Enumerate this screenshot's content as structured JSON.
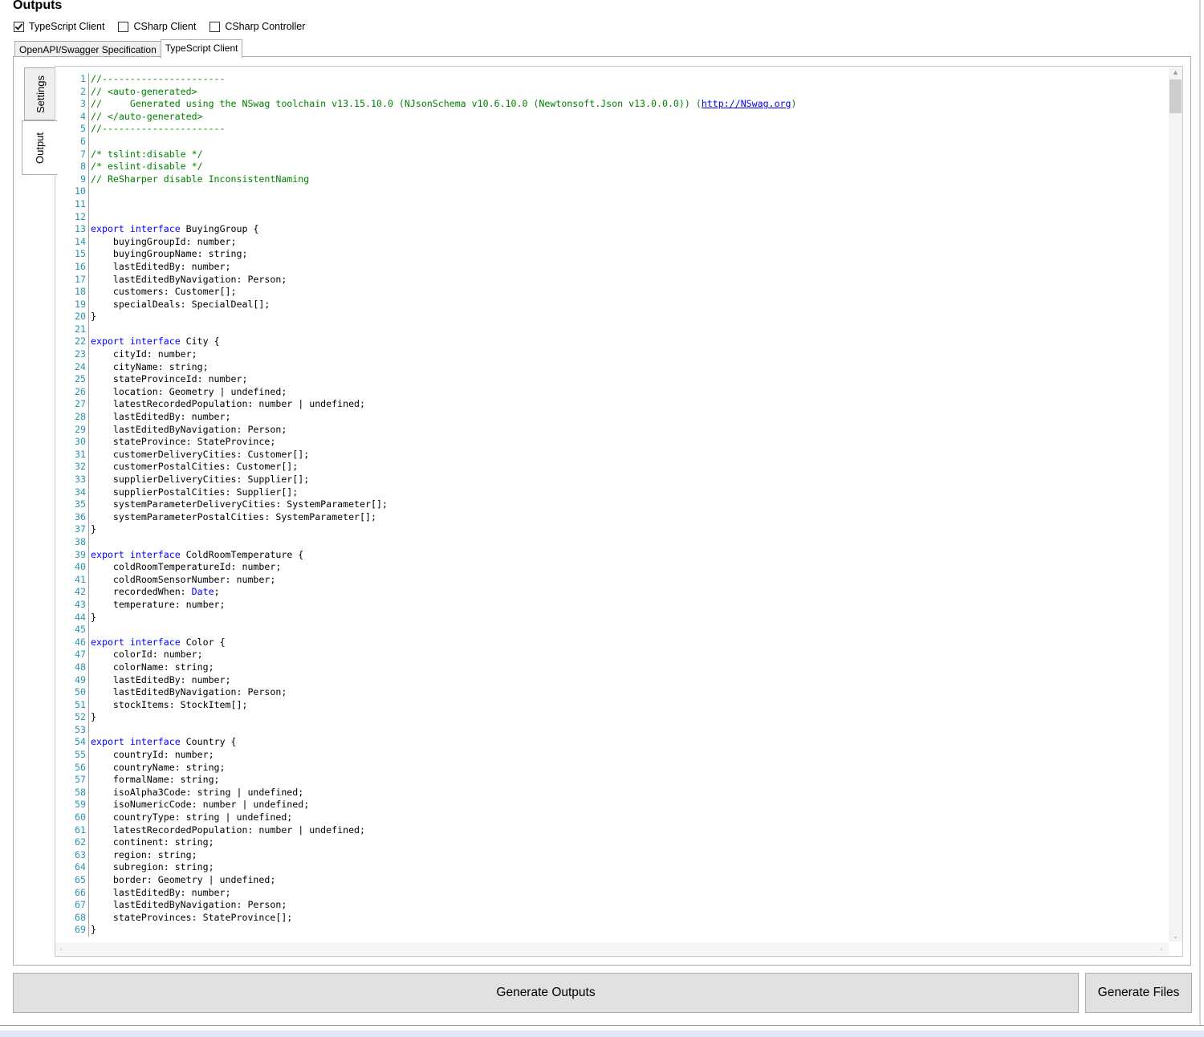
{
  "outputs": {
    "title": "Outputs",
    "checkboxes": [
      {
        "label": "TypeScript Client",
        "checked": true
      },
      {
        "label": "CSharp Client",
        "checked": false
      },
      {
        "label": "CSharp Controller",
        "checked": false
      }
    ]
  },
  "tabs": [
    {
      "label": "OpenAPI/Swagger Specification",
      "active": false
    },
    {
      "label": "TypeScript Client",
      "active": true
    }
  ],
  "side_tabs": [
    {
      "label": "Settings",
      "active": false
    },
    {
      "label": "Output",
      "active": true
    }
  ],
  "code": {
    "lines": [
      "//----------------------",
      "// <auto-generated>",
      "//     Generated using the NSwag toolchain v13.15.10.0 (NJsonSchema v10.6.10.0 (Newtonsoft.Json v13.0.0.0)) (http://NSwag.org)",
      "// </auto-generated>",
      "//----------------------",
      "",
      "/* tslint:disable */",
      "/* eslint-disable */",
      "// ReSharper disable InconsistentNaming",
      "",
      "",
      "",
      "export interface BuyingGroup {",
      "    buyingGroupId: number;",
      "    buyingGroupName: string;",
      "    lastEditedBy: number;",
      "    lastEditedByNavigation: Person;",
      "    customers: Customer[];",
      "    specialDeals: SpecialDeal[];",
      "}",
      "",
      "export interface City {",
      "    cityId: number;",
      "    cityName: string;",
      "    stateProvinceId: number;",
      "    location: Geometry | undefined;",
      "    latestRecordedPopulation: number | undefined;",
      "    lastEditedBy: number;",
      "    lastEditedByNavigation: Person;",
      "    stateProvince: StateProvince;",
      "    customerDeliveryCities: Customer[];",
      "    customerPostalCities: Customer[];",
      "    supplierDeliveryCities: Supplier[];",
      "    supplierPostalCities: Supplier[];",
      "    systemParameterDeliveryCities: SystemParameter[];",
      "    systemParameterPostalCities: SystemParameter[];",
      "}",
      "",
      "export interface ColdRoomTemperature {",
      "    coldRoomTemperatureId: number;",
      "    coldRoomSensorNumber: number;",
      "    recordedWhen: Date;",
      "    temperature: number;",
      "}",
      "",
      "export interface Color {",
      "    colorId: number;",
      "    colorName: string;",
      "    lastEditedBy: number;",
      "    lastEditedByNavigation: Person;",
      "    stockItems: StockItem[];",
      "}",
      "",
      "export interface Country {",
      "    countryId: number;",
      "    countryName: string;",
      "    formalName: string;",
      "    isoAlpha3Code: string | undefined;",
      "    isoNumericCode: number | undefined;",
      "    countryType: string | undefined;",
      "    latestRecordedPopulation: number | undefined;",
      "    continent: string;",
      "    region: string;",
      "    subregion: string;",
      "    border: Geometry | undefined;",
      "    lastEditedBy: number;",
      "    lastEditedByNavigation: Person;",
      "    stateProvinces: StateProvince[];",
      "}"
    ]
  },
  "buttons": {
    "generate_outputs": "Generate Outputs",
    "generate_files": "Generate Files"
  },
  "colors": {
    "comment": "#008000",
    "keyword": "#0000ff",
    "line_number": "#2b91af",
    "highlight": "#e8e400"
  }
}
